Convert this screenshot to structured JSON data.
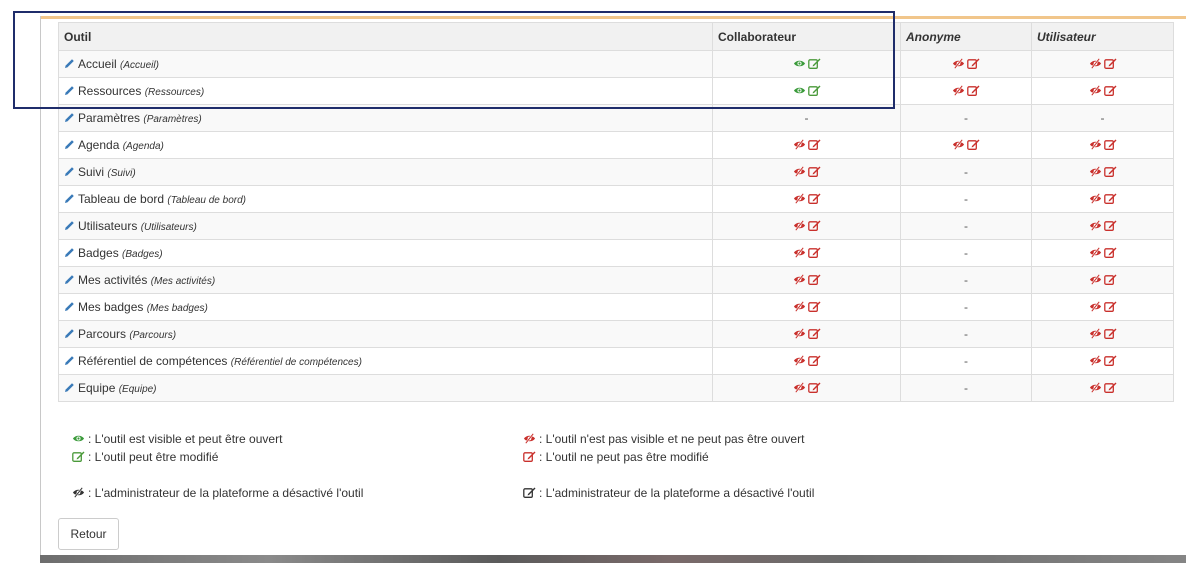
{
  "colors": {
    "visible_green": "#3a9a3a",
    "edit_green": "#4a9a3a",
    "hidden_red": "#c9302c",
    "edit_red": "#c9302c",
    "disabled_dark": "#333333",
    "pencil_blue": "#3a7ab8",
    "highlight_border": "#1f2d6b"
  },
  "table": {
    "headers": [
      "Outil",
      "Collaborateur",
      "Anonyme",
      "Utilisateur"
    ],
    "rows": [
      {
        "name": "Accueil",
        "alias": "(Accueil)",
        "collab": "visible-editable",
        "anon": "hidden-editable",
        "user": "hidden-editable"
      },
      {
        "name": "Ressources",
        "alias": "(Ressources)",
        "collab": "visible-editable",
        "anon": "hidden-editable",
        "user": "hidden-editable"
      },
      {
        "name": "Paramètres",
        "alias": "(Paramètres)",
        "collab": "-",
        "anon": "-",
        "user": "-"
      },
      {
        "name": "Agenda",
        "alias": "(Agenda)",
        "collab": "hidden-editable",
        "anon": "hidden-editable",
        "user": "hidden-editable"
      },
      {
        "name": "Suivi",
        "alias": "(Suivi)",
        "collab": "hidden-editable",
        "anon": "-",
        "user": "hidden-editable"
      },
      {
        "name": "Tableau de bord",
        "alias": "(Tableau de bord)",
        "collab": "hidden-editable",
        "anon": "-",
        "user": "hidden-editable"
      },
      {
        "name": "Utilisateurs",
        "alias": "(Utilisateurs)",
        "collab": "hidden-editable",
        "anon": "-",
        "user": "hidden-editable"
      },
      {
        "name": "Badges",
        "alias": "(Badges)",
        "collab": "hidden-editable",
        "anon": "-",
        "user": "hidden-editable"
      },
      {
        "name": "Mes activités",
        "alias": "(Mes activités)",
        "collab": "hidden-editable",
        "anon": "-",
        "user": "hidden-editable"
      },
      {
        "name": "Mes badges",
        "alias": "(Mes badges)",
        "collab": "hidden-editable",
        "anon": "-",
        "user": "hidden-editable"
      },
      {
        "name": "Parcours",
        "alias": "(Parcours)",
        "collab": "hidden-editable",
        "anon": "-",
        "user": "hidden-editable"
      },
      {
        "name": "Référentiel de compétences",
        "alias": "(Référentiel de compétences)",
        "collab": "hidden-editable",
        "anon": "-",
        "user": "hidden-editable"
      },
      {
        "name": "Equipe",
        "alias": "(Equipe)",
        "collab": "hidden-editable",
        "anon": "-",
        "user": "hidden-editable"
      }
    ]
  },
  "legend": {
    "visible": ": L'outil est visible et peut être ouvert",
    "editable": ": L'outil peut être modifié",
    "admin_disabled_visibility": ": L'administrateur de la plateforme a désactivé l'outil",
    "hidden": ": L'outil n'est pas visible et ne peut pas être ouvert",
    "not_editable": ": L'outil ne peut pas être modifié",
    "admin_disabled_edit": ": L'administrateur de la plateforme a désactivé l'outil"
  },
  "buttons": {
    "back": "Retour"
  },
  "icons": {
    "pencil": "pencil-icon",
    "visible": "eye-icon",
    "hidden": "eye-slash-icon",
    "editable": "edit-icon"
  }
}
